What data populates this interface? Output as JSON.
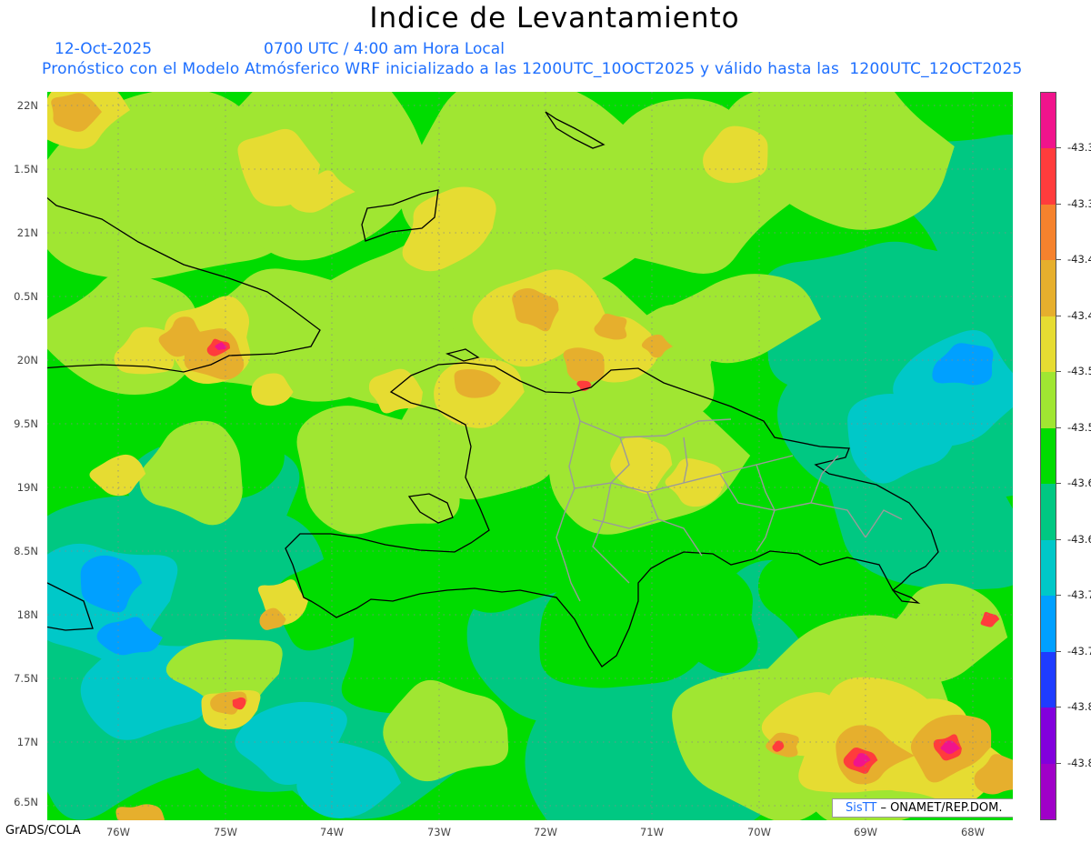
{
  "header": {
    "title": "Indice de Levantamiento",
    "date": "12-Oct-2025",
    "time": "0700 UTC / 4:00 am Hora Local",
    "caption": "Pronóstico con el Modelo Atmósferico WRF inicializado a las 1200UTC_10OCT2025 y válido hasta las  1200UTC_12OCT2025"
  },
  "axes": {
    "lat_labels": [
      "22N",
      "1.5N",
      "21N",
      "0.5N",
      "20N",
      "9.5N",
      "19N",
      "8.5N",
      "18N",
      "7.5N",
      "17N",
      "6.5N"
    ],
    "lon_labels": [
      "76W",
      "75W",
      "74W",
      "73W",
      "72W",
      "71W",
      "70W",
      "69W",
      "68W"
    ]
  },
  "colorbar": {
    "colors": [
      "#f0148c",
      "#ff3c3c",
      "#f5822d",
      "#e6af2d",
      "#e6dc32",
      "#a0e632",
      "#00dc00",
      "#00c882",
      "#00c8c8",
      "#00a0ff",
      "#1e3cff",
      "#8200dc",
      "#a000c8"
    ],
    "labels": [
      "-43.3",
      "-43.3",
      "-43.4",
      "-43.4",
      "-43.5",
      "-43.5",
      "-43.6",
      "-43.6",
      "-43.7",
      "-43.7",
      "-43.8",
      "-43.8"
    ]
  },
  "credit": {
    "logo": "SisTT",
    "org": "– ONAMET/REP.DOM."
  },
  "footer": {
    "left": "GrADS/COLA"
  }
}
